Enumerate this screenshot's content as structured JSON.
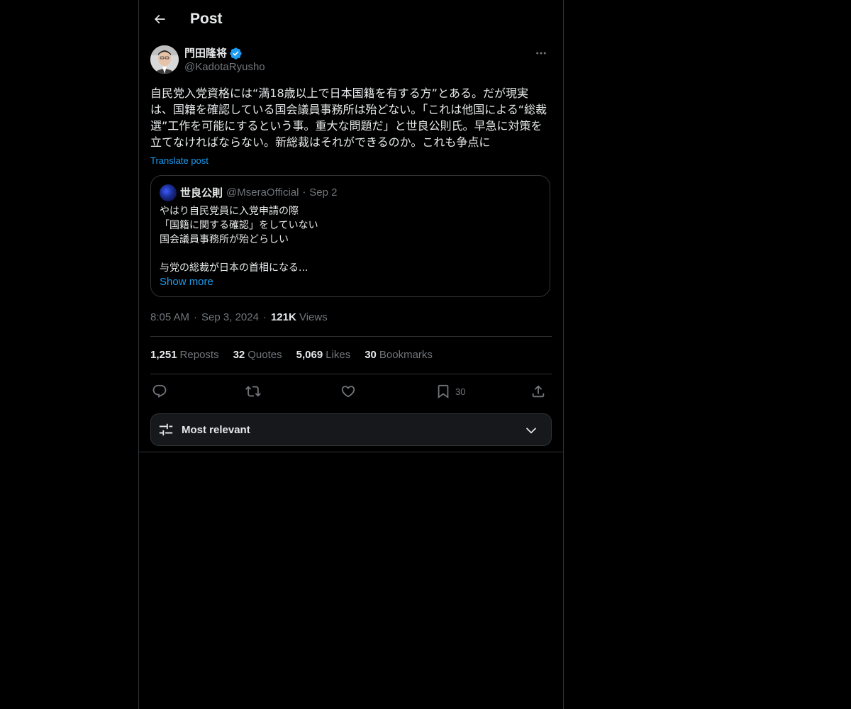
{
  "header": {
    "title": "Post"
  },
  "author": {
    "name": "門田隆将",
    "handle": "@KadotaRyusho",
    "verified": true
  },
  "post": {
    "text": "自民党入党資格には“満18歳以上で日本国籍を有する方”とある。だが現実は、国籍を確認している国会議員事務所は殆どない。「これは他国による“総裁選”工作を可能にするという事。重大な問題だ」と世良公則氏。早急に対策を立てなければならない。新総裁はそれができるのか。これも争点に",
    "translate_label": "Translate post"
  },
  "quote": {
    "name": "世良公則",
    "handle": "@MseraOfficial",
    "date": "Sep 2",
    "lines": [
      "やはり自民党員に入党申請の際",
      "「国籍に関する確認」をしていない",
      "国会議員事務所が殆どらしい",
      "",
      "与党の総裁が日本の首相になる..."
    ],
    "show_more": "Show more"
  },
  "meta": {
    "time": "8:05 AM",
    "date": "Sep 3, 2024",
    "views_count": "121K",
    "views_label": "Views"
  },
  "stats": {
    "reposts_count": "1,251",
    "reposts_label": "Reposts",
    "quotes_count": "32",
    "quotes_label": "Quotes",
    "likes_count": "5,069",
    "likes_label": "Likes",
    "bookmarks_count": "30",
    "bookmarks_label": "Bookmarks"
  },
  "actions": {
    "bookmark_count": "30"
  },
  "sort": {
    "label": "Most relevant"
  },
  "colors": {
    "background": "#000000",
    "text": "#e7e9ea",
    "muted": "#71767b",
    "accent": "#1d9bf0",
    "border": "#2f3336",
    "sort_bg": "#16181c"
  },
  "icons": [
    "back-arrow-icon",
    "verified-badge-icon",
    "more-icon",
    "reply-icon",
    "repost-icon",
    "like-icon",
    "bookmark-icon",
    "share-icon",
    "sort-sliders-icon",
    "chevron-down-icon"
  ]
}
